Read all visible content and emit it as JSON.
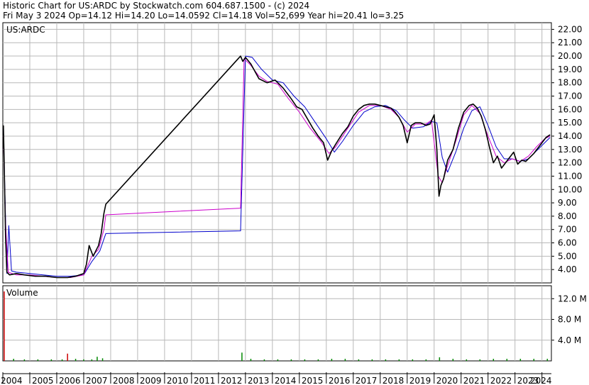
{
  "header": {
    "line1": "Historic Chart for US:ARDC by Stockwatch.com 604.687.1500 - (c) 2024",
    "line2": "Fri May  3 2024   Op=14.12   Hi=14.20   Lo=14.0592   Cl=14.18   Vol=52,699   Year hi=20.41   lo=3.25"
  },
  "chart_data": {
    "type": "line",
    "symbol_label": "US:ARDC",
    "volume_label": "Volume",
    "price_axis": {
      "ylim": [
        3.0,
        22.5
      ],
      "ticks": [
        4,
        5,
        6,
        7,
        8,
        9,
        10,
        11,
        12,
        13,
        14,
        15,
        16,
        17,
        18,
        19,
        20,
        21,
        22
      ],
      "tick_labels": [
        "4.00",
        "5.00",
        "6.00",
        "7.00",
        "8.00",
        "9.00",
        "10.00",
        "11.00",
        "12.00",
        "13.00",
        "14.00",
        "15.00",
        "16.00",
        "17.00",
        "18.00",
        "19.00",
        "20.00",
        "21.00",
        "22.00"
      ]
    },
    "volume_axis": {
      "ylim": [
        0,
        14.5
      ],
      "ticks": [
        4,
        8,
        12
      ],
      "tick_labels": [
        "4.0 M",
        "8.0 M",
        "12.0 M"
      ]
    },
    "x_axis": {
      "xlim": [
        2004.0,
        2024.35
      ],
      "year_labels": [
        "2004",
        "2005",
        "2006",
        "2007",
        "2008",
        "2009",
        "2010",
        "2011",
        "2012",
        "2013",
        "2014",
        "2015",
        "2016",
        "2017",
        "2018",
        "2019",
        "2020",
        "2021",
        "2022",
        "2023",
        "2024"
      ]
    },
    "grid": true,
    "series": [
      {
        "color": "#000000",
        "x": [
          2004.02,
          2004.05,
          2004.1,
          2004.15,
          2004.25,
          2004.5,
          2004.8,
          2005.2,
          2005.6,
          2006.0,
          2006.4,
          2006.7,
          2007.0,
          2007.1,
          2007.2,
          2007.35,
          2007.45,
          2007.55,
          2007.65,
          2007.75,
          2007.82,
          2012.82,
          2012.9,
          2013.0,
          2013.2,
          2013.5,
          2013.8,
          2014.1,
          2014.4,
          2014.7,
          2014.9,
          2015.1,
          2015.3,
          2015.5,
          2015.7,
          2015.9,
          2016.05,
          2016.2,
          2016.35,
          2016.6,
          2016.8,
          2017.0,
          2017.2,
          2017.4,
          2017.6,
          2017.8,
          2018.0,
          2018.2,
          2018.4,
          2018.55,
          2018.7,
          2018.85,
          2019.0,
          2019.15,
          2019.3,
          2019.5,
          2019.7,
          2019.85,
          2020.0,
          2020.1,
          2020.18,
          2020.25,
          2020.35,
          2020.5,
          2020.7,
          2020.9,
          2021.1,
          2021.3,
          2021.45,
          2021.6,
          2021.75,
          2021.9,
          2022.05,
          2022.2,
          2022.35,
          2022.5,
          2022.65,
          2022.8,
          2022.95,
          2023.1,
          2023.25,
          2023.4,
          2023.55,
          2023.7,
          2023.85,
          2024.0,
          2024.15,
          2024.3
        ],
        "values": [
          14.8,
          12.0,
          6.5,
          3.8,
          3.6,
          3.7,
          3.6,
          3.5,
          3.5,
          3.4,
          3.4,
          3.5,
          3.7,
          4.4,
          5.8,
          5.0,
          5.4,
          5.8,
          6.7,
          8.2,
          8.9,
          20.0,
          19.6,
          19.9,
          19.4,
          18.3,
          18.0,
          18.2,
          17.6,
          16.8,
          16.2,
          16.0,
          15.3,
          14.6,
          14.0,
          13.5,
          12.2,
          12.9,
          13.4,
          14.2,
          14.7,
          15.5,
          16.0,
          16.3,
          16.4,
          16.4,
          16.3,
          16.2,
          16.1,
          15.8,
          15.4,
          14.8,
          13.5,
          14.8,
          15.0,
          15.0,
          14.8,
          14.9,
          15.6,
          13.0,
          9.5,
          10.3,
          10.8,
          12.2,
          13.0,
          14.6,
          15.8,
          16.3,
          16.4,
          16.1,
          15.5,
          14.5,
          13.2,
          12.0,
          12.5,
          11.6,
          12.0,
          12.4,
          12.8,
          11.9,
          12.2,
          12.1,
          12.4,
          12.7,
          13.1,
          13.5,
          13.9,
          14.1
        ]
      },
      {
        "color": "#cc00cc",
        "x": [
          2004.02,
          2004.1,
          2004.2,
          2004.5,
          2005.0,
          2005.5,
          2006.0,
          2006.5,
          2007.0,
          2007.3,
          2007.55,
          2007.75,
          2007.82,
          2012.82,
          2012.95,
          2013.2,
          2013.5,
          2013.8,
          2014.2,
          2014.6,
          2015.0,
          2015.4,
          2015.8,
          2016.1,
          2016.35,
          2016.8,
          2017.2,
          2017.6,
          2018.0,
          2018.4,
          2018.7,
          2019.0,
          2019.3,
          2019.7,
          2019.9,
          2020.15,
          2020.3,
          2020.5,
          2020.8,
          2021.1,
          2021.4,
          2021.7,
          2022.0,
          2022.3,
          2022.6,
          2022.9,
          2023.2,
          2023.5,
          2023.8,
          2024.1,
          2024.3
        ],
        "values": [
          14.0,
          7.5,
          3.8,
          3.6,
          3.6,
          3.5,
          3.4,
          3.4,
          3.6,
          5.0,
          5.5,
          7.0,
          8.1,
          8.6,
          19.8,
          19.3,
          18.5,
          18.1,
          17.9,
          16.8,
          15.8,
          14.6,
          13.6,
          12.7,
          13.2,
          14.6,
          15.8,
          16.3,
          16.3,
          16.0,
          15.4,
          14.3,
          14.9,
          14.9,
          15.2,
          11.0,
          10.5,
          11.8,
          13.6,
          15.6,
          16.3,
          15.7,
          14.0,
          12.5,
          12.0,
          12.3,
          12.1,
          12.5,
          13.2,
          13.8,
          14.0
        ]
      },
      {
        "color": "#0000cc",
        "x": [
          2004.02,
          2004.15,
          2004.22,
          2004.32,
          2004.5,
          2005.0,
          2005.5,
          2006.0,
          2006.5,
          2007.0,
          2007.3,
          2007.6,
          2007.82,
          2012.82,
          2013.0,
          2013.25,
          2013.6,
          2014.0,
          2014.4,
          2014.8,
          2015.2,
          2015.6,
          2016.0,
          2016.3,
          2016.6,
          2017.0,
          2017.4,
          2017.8,
          2018.2,
          2018.6,
          2018.9,
          2019.2,
          2019.6,
          2019.9,
          2020.1,
          2020.3,
          2020.5,
          2020.8,
          2021.1,
          2021.4,
          2021.7,
          2022.0,
          2022.3,
          2022.6,
          2022.9,
          2023.2,
          2023.5,
          2023.8,
          2024.1,
          2024.3
        ],
        "values": [
          14.5,
          3.7,
          7.3,
          3.9,
          3.8,
          3.7,
          3.6,
          3.5,
          3.5,
          3.6,
          4.6,
          5.4,
          6.7,
          6.9,
          20.0,
          19.9,
          19.0,
          18.2,
          18.0,
          17.0,
          16.2,
          15.0,
          13.8,
          12.8,
          13.6,
          14.8,
          15.8,
          16.2,
          16.3,
          15.9,
          15.2,
          14.6,
          14.7,
          15.1,
          15.0,
          12.4,
          11.3,
          12.8,
          14.6,
          15.9,
          16.2,
          14.8,
          13.2,
          12.3,
          12.3,
          12.1,
          12.3,
          12.9,
          13.5,
          13.9
        ]
      }
    ],
    "volume": {
      "x": [
        2004.05,
        2004.4,
        2004.8,
        2005.3,
        2005.8,
        2006.2,
        2006.4,
        2006.7,
        2007.0,
        2007.3,
        2007.5,
        2007.7,
        2012.87,
        2013.2,
        2013.7,
        2014.2,
        2014.7,
        2015.2,
        2015.7,
        2016.2,
        2016.7,
        2017.2,
        2017.7,
        2018.2,
        2018.7,
        2019.2,
        2019.7,
        2020.2,
        2020.7,
        2021.2,
        2021.7,
        2022.2,
        2022.7,
        2023.2,
        2023.7,
        2024.2
      ],
      "values": [
        13.4,
        0.4,
        0.3,
        0.3,
        0.3,
        0.3,
        1.4,
        0.4,
        0.3,
        0.3,
        0.8,
        0.5,
        1.6,
        0.4,
        0.3,
        0.3,
        0.3,
        0.3,
        0.3,
        0.4,
        0.4,
        0.3,
        0.3,
        0.3,
        0.3,
        0.3,
        0.3,
        0.7,
        0.4,
        0.3,
        0.3,
        0.4,
        0.4,
        0.4,
        0.4,
        0.4
      ]
    }
  }
}
